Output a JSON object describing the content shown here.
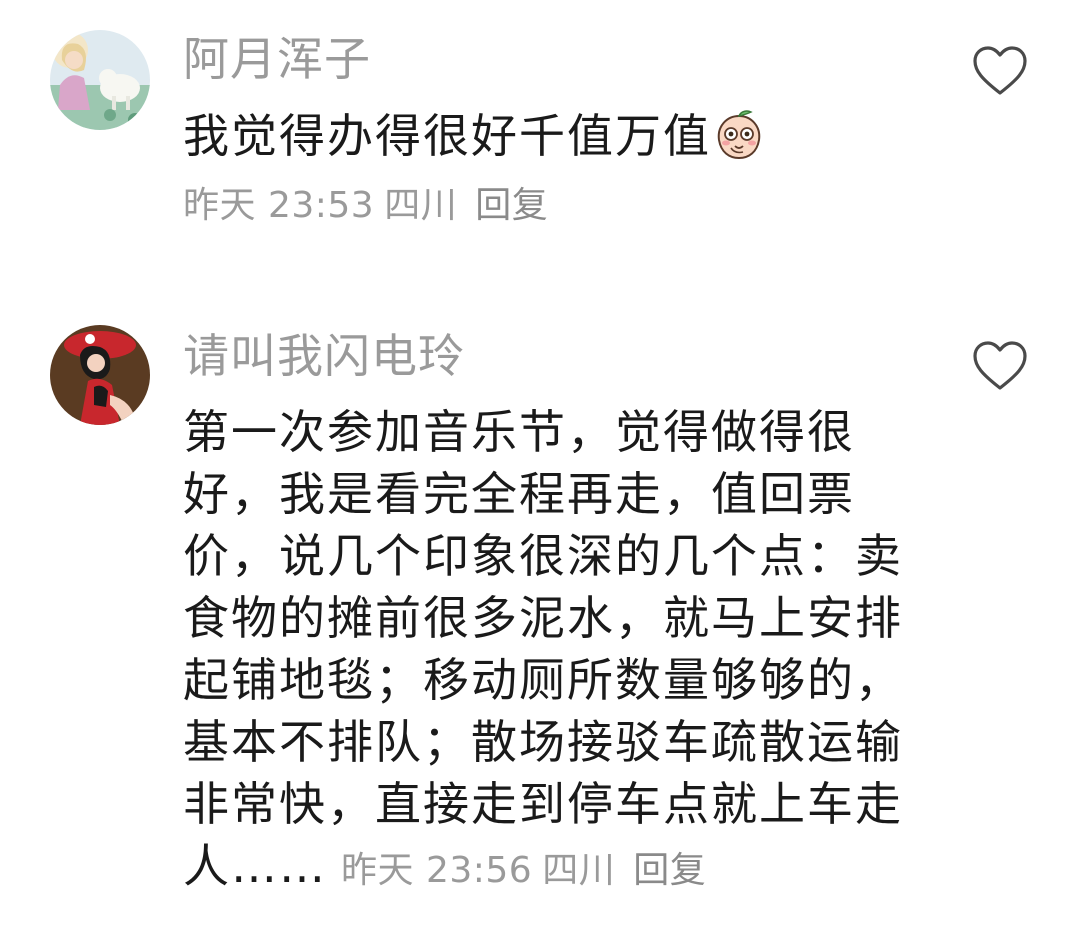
{
  "comments": [
    {
      "username": "阿月浑子",
      "avatar_icon": "avatar-girl-with-goat",
      "text": "我觉得办得很好千值万值",
      "emoji": "peach-face-emoji",
      "time": "昨天 23:53",
      "location": "四川",
      "reply": "回复",
      "like_icon": "heart-outline-icon"
    },
    {
      "username": "请叫我闪电玲",
      "avatar_icon": "avatar-girl-red-hat",
      "lines": [
        "第一次参加音乐节，觉得做得很",
        "好，我是看完全程再走，值回票",
        "价，说几个印象很深的几个点：卖",
        "食物的摊前很多泥水，就马上安排",
        "起铺地毯；移动厕所数量够够的，",
        "基本不排队；散场接驳车疏散运输",
        "非常快，直接走到停车点就上车走"
      ],
      "last_line_text": "人……",
      "time": "昨天 23:56",
      "location": "四川",
      "reply": "回复",
      "like_icon": "heart-outline-icon"
    }
  ],
  "colors": {
    "text_primary": "#1a1a1a",
    "text_secondary": "#9a9a9a",
    "background": "#ffffff"
  }
}
